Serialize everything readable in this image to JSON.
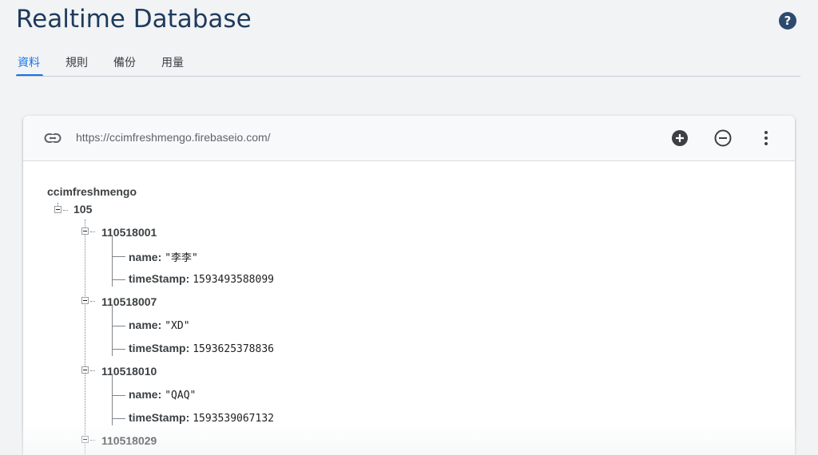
{
  "header": {
    "title": "Realtime Database",
    "help_icon": "help-circle-icon"
  },
  "tabs": [
    {
      "label": "資料",
      "active": true
    },
    {
      "label": "規則",
      "active": false
    },
    {
      "label": "備份",
      "active": false
    },
    {
      "label": "用量",
      "active": false
    }
  ],
  "toolbar": {
    "link_icon": "link-icon",
    "url": "https://ccimfreshmengo.firebaseio.com/",
    "add_icon": "add-circle-icon",
    "remove_icon": "remove-circle-icon",
    "more_icon": "more-vert-icon"
  },
  "tree": {
    "root": "ccimfreshmengo",
    "group": "105",
    "records": [
      {
        "key": "110518001",
        "name_label": "name:",
        "name_value": "\"李李\"",
        "ts_label": "timeStamp:",
        "ts_value": "1593493588099"
      },
      {
        "key": "110518007",
        "name_label": "name:",
        "name_value": "\"XD\"",
        "ts_label": "timeStamp:",
        "ts_value": "1593625378836"
      },
      {
        "key": "110518010",
        "name_label": "name:",
        "name_value": "\"QAQ\"",
        "ts_label": "timeStamp:",
        "ts_value": "1593539067132"
      },
      {
        "key": "110518029"
      }
    ]
  },
  "colors": {
    "accent": "#1a73e8",
    "title": "#1f3a5c",
    "background": "#f1f3f4"
  }
}
